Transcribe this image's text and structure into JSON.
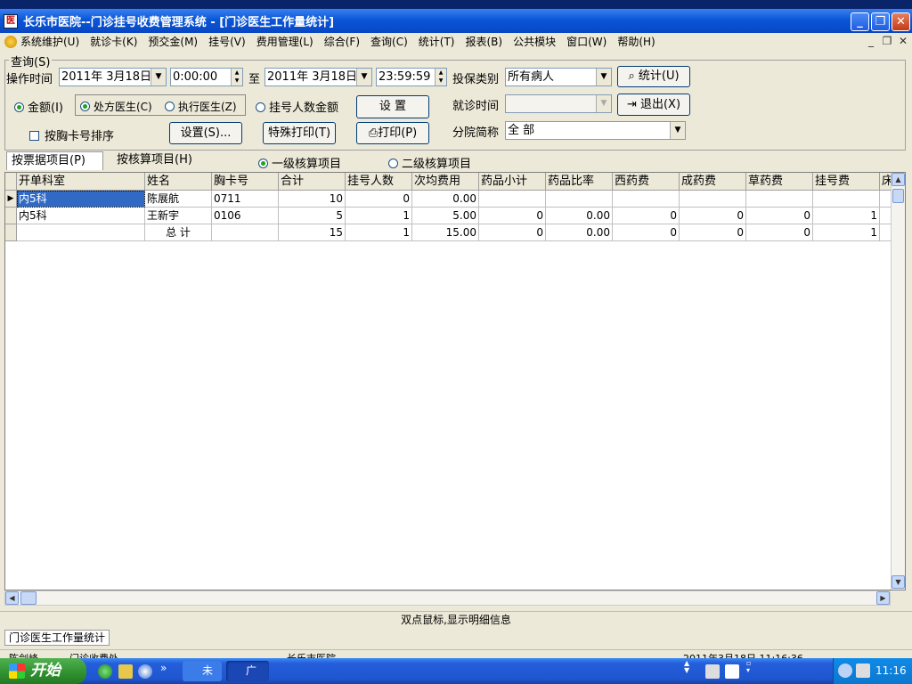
{
  "window": {
    "title": "长乐市医院--门诊挂号收费管理系统 - [门诊医生工作量统计]",
    "min": "_",
    "restore": "❐",
    "close": "✕"
  },
  "menu": {
    "items": [
      "系统维护(U)",
      "就诊卡(K)",
      "预交金(M)",
      "挂号(V)",
      "费用管理(L)",
      "综合(F)",
      "查询(C)",
      "统计(T)",
      "报表(B)",
      "公共模块",
      "窗口(W)",
      "帮助(H)"
    ],
    "mdi_min": "_",
    "mdi_restore": "❐",
    "mdi_close": "✕"
  },
  "query": {
    "group_label": "查询(S)",
    "op_time_label": "操作时间",
    "date_from": "2011年 3月18日",
    "time_from": "0:00:00",
    "to_label": "至",
    "date_to": "2011年 3月18日",
    "time_to": "23:59:59",
    "insurance_label": "投保类别",
    "insurance_value": "所有病人",
    "stat_button": "统计(U)",
    "amount_radio": "金额(I)",
    "doctor_rx_radio": "处方医生(C)",
    "doctor_exec_radio": "执行医生(Z)",
    "reg_count_radio": "挂号人数金额",
    "setup_button": "设 置",
    "visit_time_label": "就诊时间",
    "visit_time_value": "",
    "exit_button": "退出(X)",
    "sort_checkbox": "按胸卡号排序",
    "settings_button": "设置(S)...",
    "special_print_button": "特殊打印(T)",
    "print_button": "打印(P)",
    "branch_label": "分院简称",
    "branch_value": "全 部"
  },
  "tabs": {
    "tab1": "按票据项目(P)",
    "tab2": "按核算项目(H)",
    "level1": "一级核算项目",
    "level2": "二级核算项目"
  },
  "grid": {
    "columns": [
      "开单科室",
      "姓名",
      "胸卡号",
      "合计",
      "挂号人数",
      "次均费用",
      "药品小计",
      "药品比率",
      "西药费",
      "成药费",
      "草药费",
      "挂号费",
      "床"
    ],
    "rows": [
      [
        "内5科",
        "陈展航",
        "0711",
        "10",
        "0",
        "0.00",
        "",
        "",
        "",
        "",
        "",
        "",
        ""
      ],
      [
        "内5科",
        "王新宇",
        "0106",
        "5",
        "1",
        "5.00",
        "0",
        "0.00",
        "0",
        "0",
        "0",
        "1",
        ""
      ],
      [
        "",
        "总 计",
        "",
        "15",
        "1",
        "15.00",
        "0",
        "0.00",
        "0",
        "0",
        "0",
        "1",
        ""
      ]
    ]
  },
  "status": {
    "message": "双点鼠标,显示明细信息",
    "window_tab": "门诊医生工作量统计",
    "bottom_1": "陈剑峰",
    "bottom_2": "门诊收费处",
    "bottom_3": "长乐市医院",
    "bottom_4": "2011年3月18日 11:16:36"
  },
  "taskbar": {
    "start": "开始",
    "task1": "未",
    "task2": "广",
    "clock": "11:16"
  }
}
